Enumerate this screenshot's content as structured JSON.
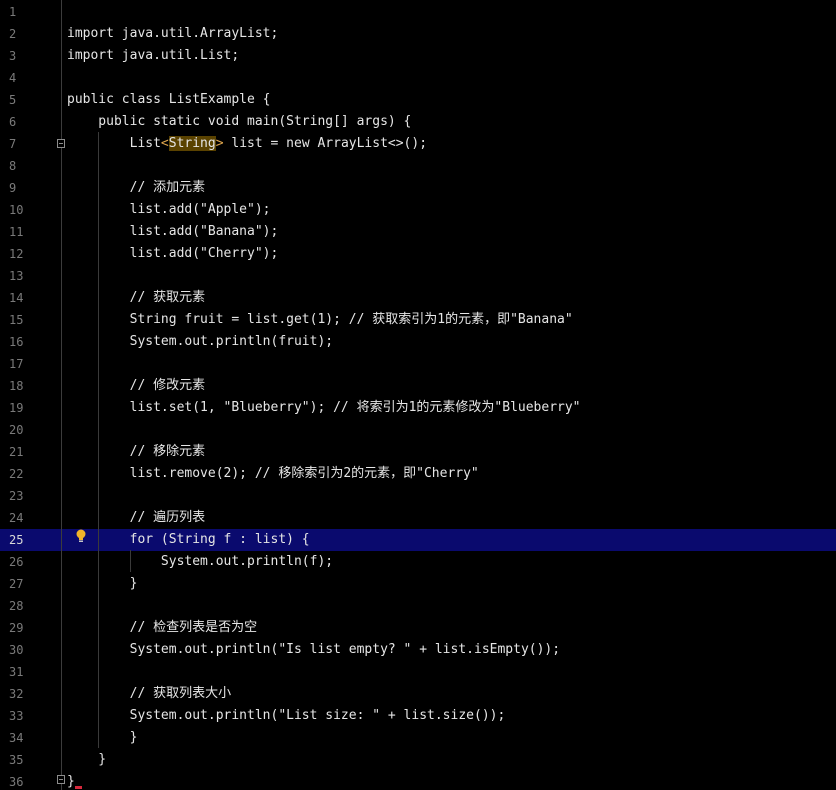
{
  "editor": {
    "language": "java",
    "current_line": 25,
    "lines": [
      {
        "n": "1",
        "text": ""
      },
      {
        "n": "2",
        "text": "import java.util.ArrayList;"
      },
      {
        "n": "3",
        "text": "import java.util.List;"
      },
      {
        "n": "4",
        "text": ""
      },
      {
        "n": "5",
        "text": "public class ListExample {"
      },
      {
        "n": "6",
        "text": "    public static void main(String[] args) {"
      },
      {
        "n": "7",
        "pre": "        List",
        "lt": "<",
        "hl": "String",
        "gt": ">",
        "post": " list = new ArrayList<>();"
      },
      {
        "n": "8",
        "text": ""
      },
      {
        "n": "9",
        "text": "        // 添加元素"
      },
      {
        "n": "10",
        "text": "        list.add(\"Apple\");"
      },
      {
        "n": "11",
        "text": "        list.add(\"Banana\");"
      },
      {
        "n": "12",
        "text": "        list.add(\"Cherry\");"
      },
      {
        "n": "13",
        "text": ""
      },
      {
        "n": "14",
        "text": "        // 获取元素"
      },
      {
        "n": "15",
        "text": "        String fruit = list.get(1); // 获取索引为1的元素，即\"Banana\""
      },
      {
        "n": "16",
        "text": "        System.out.println(fruit);"
      },
      {
        "n": "17",
        "text": ""
      },
      {
        "n": "18",
        "text": "        // 修改元素"
      },
      {
        "n": "19",
        "text": "        list.set(1, \"Blueberry\"); // 将索引为1的元素修改为\"Blueberry\""
      },
      {
        "n": "20",
        "text": ""
      },
      {
        "n": "21",
        "text": "        // 移除元素"
      },
      {
        "n": "22",
        "text": "        list.remove(2); // 移除索引为2的元素，即\"Cherry\""
      },
      {
        "n": "23",
        "text": ""
      },
      {
        "n": "24",
        "text": "        // 遍历列表"
      },
      {
        "n": "25",
        "text": "        for (String f : list) {"
      },
      {
        "n": "26",
        "text": "            System.out.println(f);"
      },
      {
        "n": "27",
        "text": "        }"
      },
      {
        "n": "28",
        "text": ""
      },
      {
        "n": "29",
        "text": "        // 检查列表是否为空"
      },
      {
        "n": "30",
        "text": "        System.out.println(\"Is list empty? \" + list.isEmpty());"
      },
      {
        "n": "31",
        "text": ""
      },
      {
        "n": "32",
        "text": "        // 获取列表大小"
      },
      {
        "n": "33",
        "text": "        System.out.println(\"List size: \" + list.size());"
      },
      {
        "n": "34",
        "text": "        }"
      },
      {
        "n": "35",
        "text": "    }"
      },
      {
        "n": "36",
        "text": "}"
      }
    ]
  },
  "icons": {
    "fold": "fold-toggle-icon",
    "intention": "lightbulb-icon"
  },
  "colors": {
    "background": "#000000",
    "current_line": "#0a0a6e",
    "text": "#e6e6e6",
    "line_number": "#7a7a7a",
    "bracket_match": "#5a4200",
    "bulb": "#f0b429"
  }
}
